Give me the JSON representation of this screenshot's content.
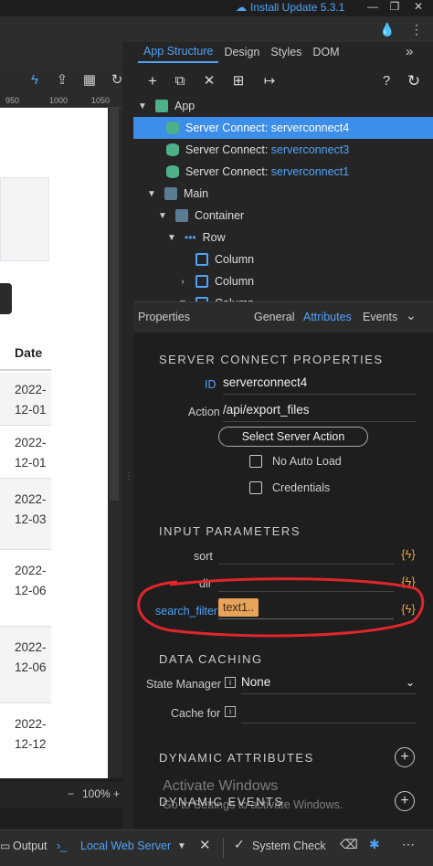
{
  "titlebar": {
    "update_label": "Install Update 5.3.1"
  },
  "ruler": {
    "ticks": [
      "950",
      "1000",
      "1050"
    ]
  },
  "canvas": {
    "date_header": "Date",
    "dates": [
      "2022-\n12-01",
      "2022-\n12-01",
      "2022-\n12-03",
      "2022-\n12-06",
      "2022-\n12-06",
      "2022-\n12-12"
    ],
    "zoom": "100%"
  },
  "tabs": {
    "app_structure": "App Structure",
    "design": "Design",
    "styles": "Styles",
    "dom": "DOM"
  },
  "tree": {
    "app": "App",
    "sc_prefix": "Server Connect: ",
    "sc1": "serverconnect4",
    "sc2": "serverconnect3",
    "sc3": "serverconnect1",
    "main": "Main",
    "container": "Container",
    "row": "Row",
    "column1": "Column",
    "column2": "Column",
    "column3": "Column"
  },
  "properties": {
    "title": "Properties",
    "tab_general": "General",
    "tab_attributes": "Attributes",
    "tab_events": "Events",
    "section_sc": "SERVER CONNECT PROPERTIES",
    "id_label": "ID",
    "id_value": "serverconnect4",
    "action_label": "Action",
    "action_value": "/api/export_files",
    "select_action_button": "Select Server Action",
    "no_auto_load": "No Auto Load",
    "credentials": "Credentials",
    "section_input": "INPUT PARAMETERS",
    "param_sort": "sort",
    "param_dir": "dir",
    "param_search": "search_filter",
    "search_value": "text1..",
    "section_caching": "DATA CACHING",
    "state_manager_label": "State Manager",
    "state_manager_value": "None",
    "cache_for_label": "Cache for",
    "section_dyn_attr": "DYNAMIC ATTRIBUTES",
    "section_dyn_events": "DYNAMIC EVENTS"
  },
  "watermark": {
    "line1": "Activate Windows",
    "line2": "Go to Settings to activate Windows."
  },
  "bottombar": {
    "output": "Output",
    "local_server": "Local Web Server",
    "system_check": "System Check"
  },
  "colors": {
    "accent": "#4fa3f7",
    "selection": "#3d8ee8",
    "annotation": "#e0262b",
    "flash": "#e8a33d"
  }
}
